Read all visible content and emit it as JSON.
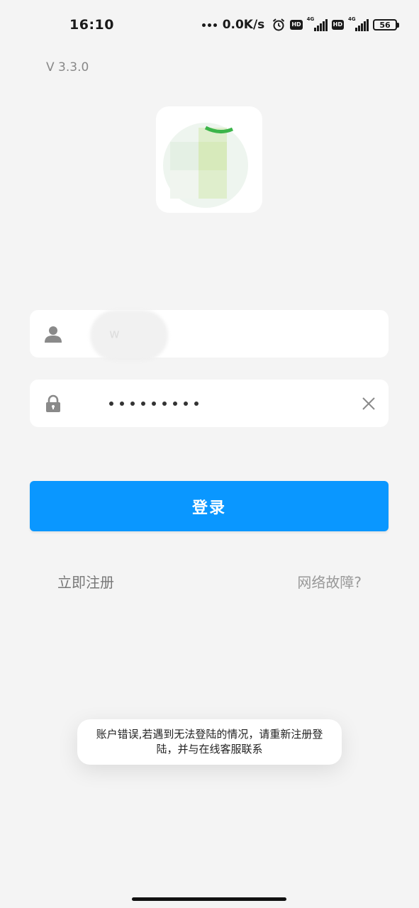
{
  "status_bar": {
    "time": "16:10",
    "net_speed": "0.0K/s",
    "hd_label": "HD",
    "network_label": "4G",
    "battery": "56",
    "alarm_icon": "alarm-icon"
  },
  "app": {
    "version": "V 3.3.0"
  },
  "login": {
    "username_value": "w",
    "password_dots_count": 9,
    "login_label": "登录",
    "register_link": "立即注册",
    "network_link": "网络故障?"
  },
  "toast": {
    "message": "账户错误,若遇到无法登陆的情况，请重新注册登陆，并与在线客服联系"
  },
  "icons": {
    "user": "user-icon",
    "lock": "lock-icon",
    "clear": "close-icon"
  },
  "colors": {
    "accent": "#0a97ff",
    "background": "#f4f4f4"
  }
}
